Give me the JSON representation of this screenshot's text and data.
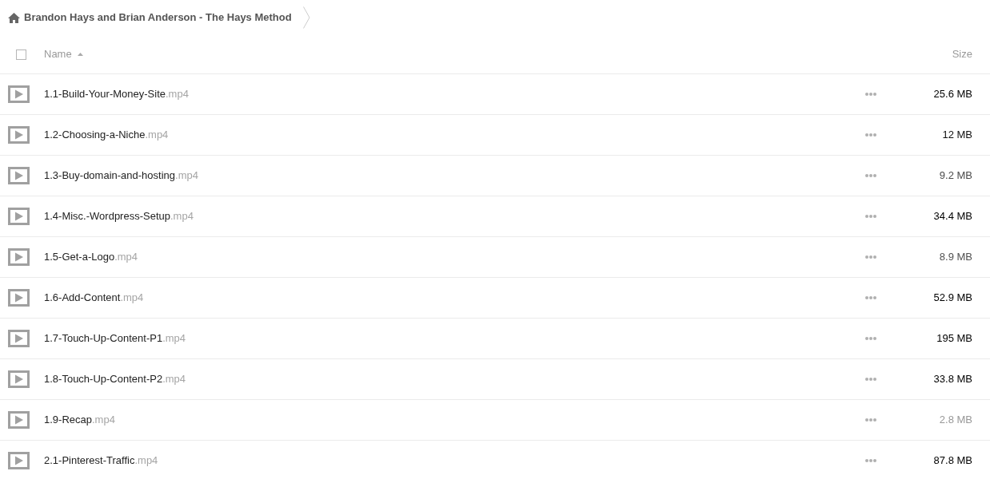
{
  "breadcrumb": {
    "title": "Brandon Hays and Brian Anderson - The Hays Method"
  },
  "table": {
    "select_all": {
      "checked": false
    },
    "columns": [
      "Name",
      "Size"
    ],
    "rows": [
      {
        "name": "1.1-Build-Your-Money-Site",
        "extension": ".mp4",
        "size": "25.6 MB",
        "color": "#000000"
      },
      {
        "name": "1.2-Choosing-a-Niche",
        "extension": ".mp4",
        "size": "12 MB",
        "color": "#101010"
      },
      {
        "name": "1.3-Buy-domain-and-hosting",
        "extension": ".mp4",
        "size": "9.2 MB",
        "color": "#4b4b4b"
      },
      {
        "name": "1.4-Misc.-Wordpress-Setup",
        "extension": ".mp4",
        "size": "34.4 MB",
        "color": "#000000"
      },
      {
        "name": "1.5-Get-a-Logo",
        "extension": ".mp4",
        "size": "8.9 MB",
        "color": "#515151"
      },
      {
        "name": "1.6-Add-Content",
        "extension": ".mp4",
        "size": "52.9 MB",
        "color": "#000000"
      },
      {
        "name": "1.7-Touch-Up-Content-P1",
        "extension": ".mp4",
        "size": "195 MB",
        "color": "#000000"
      },
      {
        "name": "1.8-Touch-Up-Content-P2",
        "extension": ".mp4",
        "size": "33.8 MB",
        "color": "#000000"
      },
      {
        "name": "1.9-Recap",
        "extension": ".mp4",
        "size": "2.8 MB",
        "color": "#989898"
      },
      {
        "name": "2.1-Pinterest-Traffic",
        "extension": ".mp4",
        "size": "87.8 MB",
        "color": "#000000"
      }
    ]
  }
}
